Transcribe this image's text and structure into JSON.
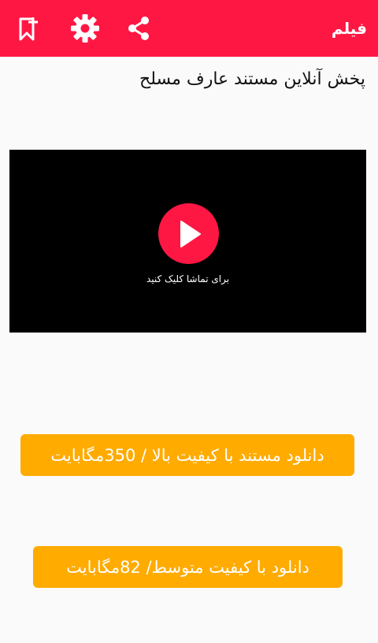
{
  "appbar": {
    "title": "فیلم",
    "background": "#ff1744",
    "icons": {
      "bookmark": "bookmark-add-icon",
      "settings": "gear-icon",
      "share": "share-icon"
    }
  },
  "main": {
    "title": "پخش  آنلاین مستند عارف مسلح"
  },
  "video": {
    "play_caption": "برای تماشا کلیک کنید",
    "play_icon": "play-icon"
  },
  "downloads": {
    "high_label": "دانلود مستند با کیفیت بالا / 350مگابایت",
    "medium_label": "دانلود با کیفیت متوسط/ 82مگابایت",
    "button_color": "#ffab00"
  }
}
